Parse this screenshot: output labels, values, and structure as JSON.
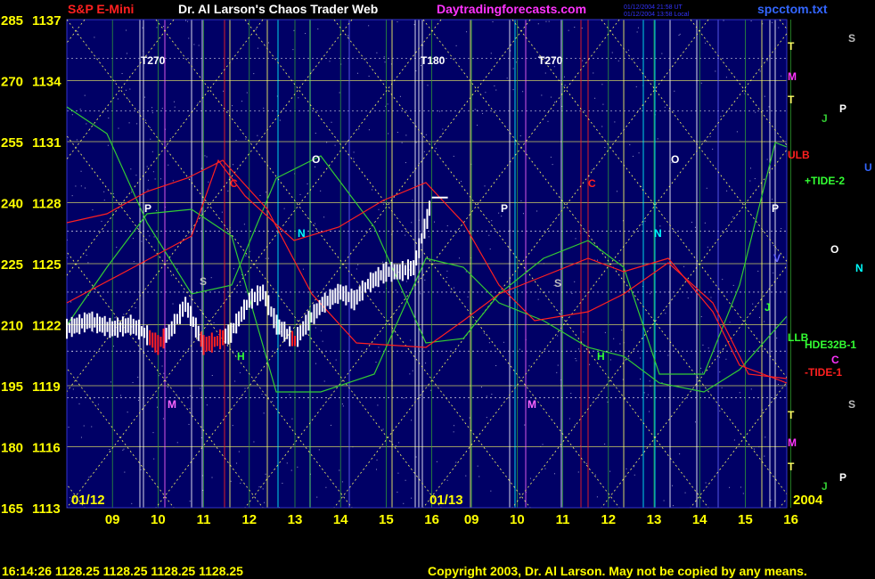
{
  "header": {
    "symbol": "S&P E-Mini",
    "title": "Dr. Al Larson's Chaos Trader Web",
    "site": "Daytradingforecasts.com",
    "timestamp_1": "01/12/2004 21:58 UT",
    "timestamp_2": "01/12/2004 13:58 Local",
    "filename": "spcctom.txt"
  },
  "footer": {
    "quote": "16:14:26  1128.25  1128.25  1128.25  1128.25",
    "copyright": "Copyright 2003, Dr. Al Larson. May not be copied by any means."
  },
  "colors": {
    "background": "#000000",
    "plot_background": "#000066",
    "header_red": "#ff2020",
    "header_white": "#ffffff",
    "header_magenta": "#ff33ff",
    "header_blue": "#3366ff",
    "axis_text": "#ffff00",
    "footer_text": "#ffff00",
    "price_bars": "#ffffff",
    "red_line": "#ff2020",
    "green_line": "#33cc33",
    "diagonal_grid": "#ffff66",
    "horizontal_grid": "#cccc66"
  },
  "chart_data": {
    "type": "line",
    "ylim": [
      1113,
      1137
    ],
    "yticks": [
      {
        "left": "165",
        "right": "1113"
      },
      {
        "left": "180",
        "right": "1116"
      },
      {
        "left": "195",
        "right": "1119"
      },
      {
        "left": "210",
        "right": "1122"
      },
      {
        "left": "225",
        "right": "1125"
      },
      {
        "left": "240",
        "right": "1128"
      },
      {
        "left": "255",
        "right": "1131"
      },
      {
        "left": "270",
        "right": "1134"
      },
      {
        "left": "285",
        "right": "1137"
      }
    ],
    "day1_hours": [
      "09",
      "10",
      "11",
      "12",
      "13",
      "14",
      "15",
      "16"
    ],
    "day2_hours": [
      "09",
      "10",
      "11",
      "12",
      "13",
      "14",
      "15",
      "16"
    ],
    "day_labels": [
      "01/12",
      "01/13"
    ],
    "year_label": "2004",
    "price_series": {
      "name": "",
      "x": [
        8.0,
        8.5,
        9.0,
        9.4,
        9.7,
        10.0,
        10.3,
        10.6,
        11.0,
        11.3,
        11.6,
        12.0,
        12.3,
        12.6,
        13.0,
        13.3,
        13.6,
        14.0,
        14.3,
        14.6,
        15.0,
        15.3,
        15.6,
        15.9,
        16.0
      ],
      "y": [
        1121.8,
        1122.2,
        1121.8,
        1122.0,
        1121.6,
        1121.0,
        1121.8,
        1123.0,
        1121.0,
        1121.2,
        1121.6,
        1123.2,
        1123.6,
        1122.0,
        1121.2,
        1122.2,
        1123.0,
        1123.6,
        1123.2,
        1124.0,
        1124.6,
        1124.6,
        1124.8,
        1127.2,
        1128.25
      ]
    },
    "overlay_labels": [
      {
        "text": "T270",
        "kind": "top"
      },
      {
        "text": "T180",
        "kind": "top"
      },
      {
        "text": "T270",
        "kind": "top"
      },
      {
        "text": "P"
      },
      {
        "text": "C"
      },
      {
        "text": "S"
      },
      {
        "text": "N"
      },
      {
        "text": "O"
      },
      {
        "text": "H"
      },
      {
        "text": "M"
      },
      {
        "text": "P"
      },
      {
        "text": "C"
      },
      {
        "text": "S"
      },
      {
        "text": "N"
      },
      {
        "text": "O"
      },
      {
        "text": "H"
      },
      {
        "text": "M"
      },
      {
        "text": "P"
      },
      {
        "text": "J"
      },
      {
        "text": "V"
      }
    ],
    "right_labels": [
      {
        "text": "T"
      },
      {
        "text": "M"
      },
      {
        "text": "T"
      },
      {
        "text": "ULB"
      },
      {
        "text": "+TIDE-2"
      },
      {
        "text": "LLB"
      },
      {
        "text": "HDE32B-1"
      },
      {
        "text": "-TIDE-1"
      },
      {
        "text": "T"
      },
      {
        "text": "M"
      },
      {
        "text": "T"
      }
    ],
    "planet_labels": [
      {
        "text": "S"
      },
      {
        "text": "J"
      },
      {
        "text": "P"
      },
      {
        "text": "U"
      },
      {
        "text": "O"
      },
      {
        "text": "N"
      },
      {
        "text": "C"
      },
      {
        "text": "S"
      },
      {
        "text": "P"
      },
      {
        "text": "J"
      }
    ]
  }
}
